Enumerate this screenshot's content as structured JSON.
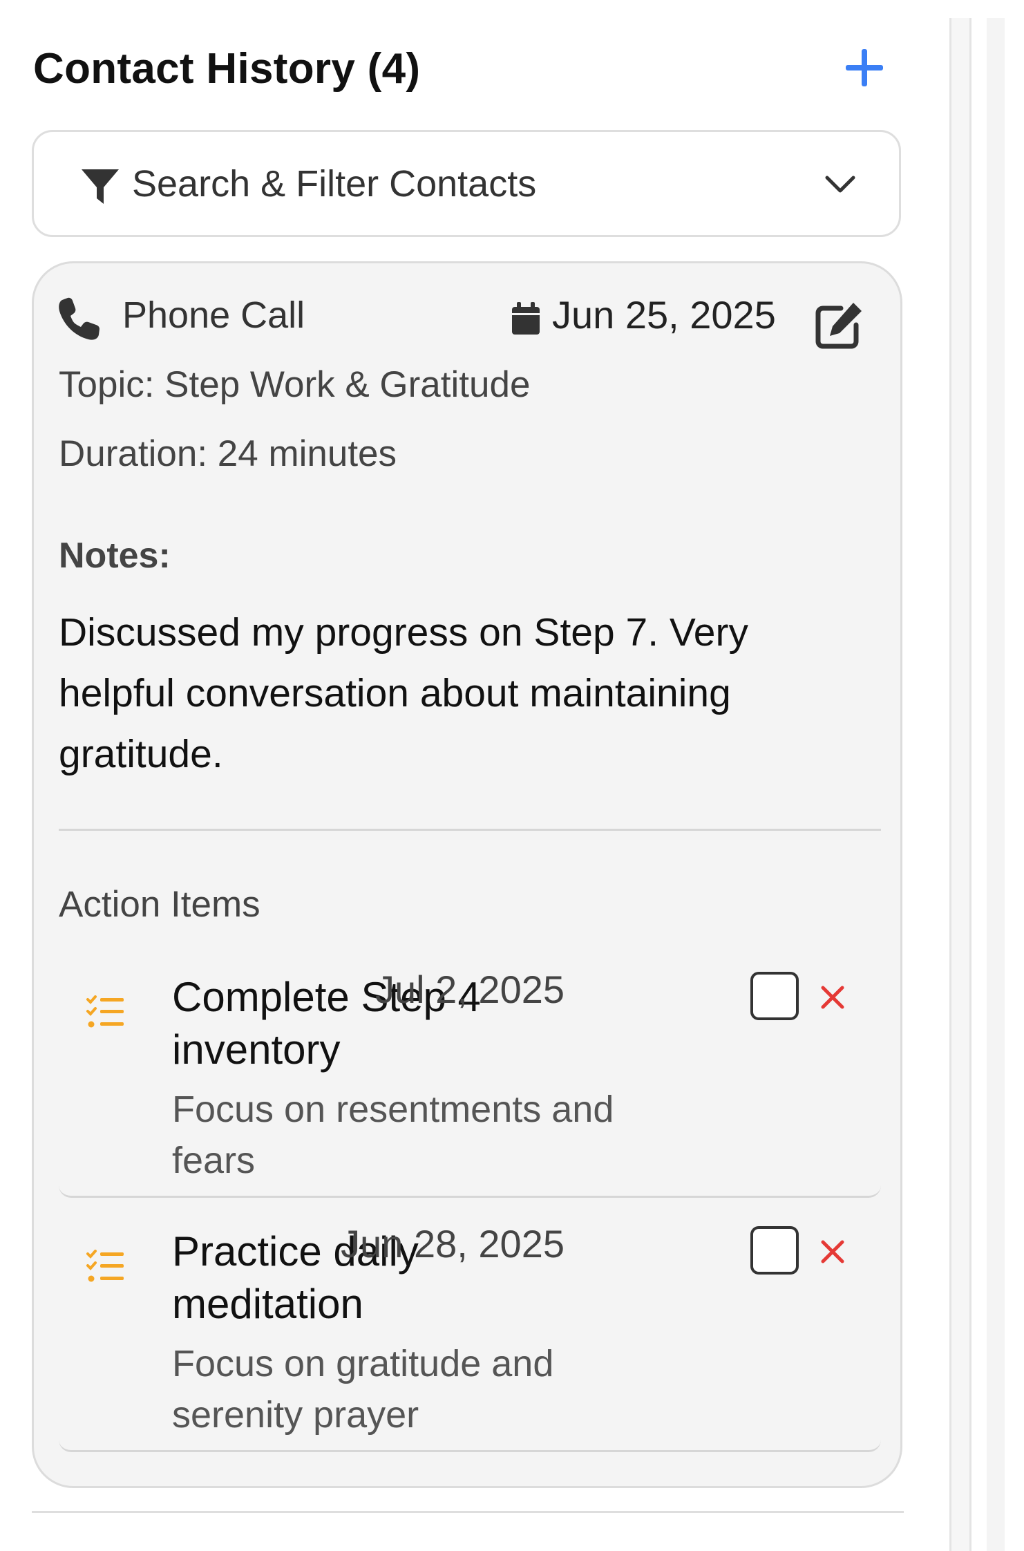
{
  "header": {
    "title": "Contact History (4)",
    "add_icon": "plus-icon"
  },
  "filter": {
    "label": "Search & Filter Contacts",
    "filter_icon": "filter-funnel-icon",
    "chevron_icon": "chevron-down-icon"
  },
  "contact": {
    "type": "Phone Call",
    "type_icon": "phone-icon",
    "date": "Jun 25, 2025",
    "date_icon": "calendar-icon",
    "edit_icon": "edit-icon",
    "topic": "Topic: Step Work & Gratitude",
    "duration": "Duration: 24 minutes",
    "notes_label": "Notes:",
    "notes": "Discussed my progress on Step 7. Very helpful conversation about maintaining gratitude.",
    "action_items_label": "Action Items",
    "action_items": [
      {
        "title": "Complete Step 4 inventory",
        "due": "Jul 2, 2025",
        "description": "Focus on resentments and fears",
        "completed": false
      },
      {
        "title": "Practice daily meditation",
        "due": "Jun 28, 2025",
        "description": "Focus on gratitude and serenity prayer",
        "completed": false
      }
    ]
  },
  "colors": {
    "accent": "#3b7ff5",
    "task_icon": "#f5a623",
    "delete": "#e53935",
    "card_bg": "#f4f4f4"
  }
}
